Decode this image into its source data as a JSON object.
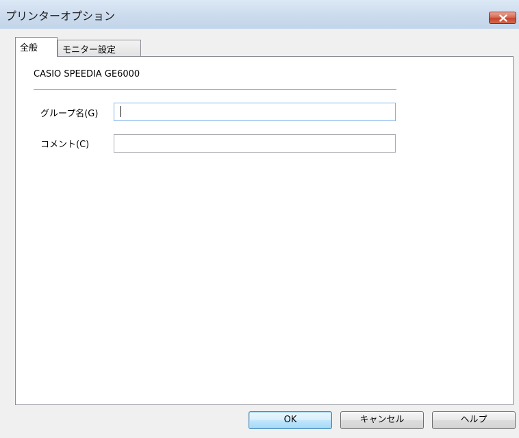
{
  "window": {
    "title": "プリンターオプション",
    "close_icon": "close-icon"
  },
  "tabs": [
    {
      "label": "全般",
      "active": true
    },
    {
      "label": "モニター設定",
      "active": false
    }
  ],
  "general": {
    "printer_name": "CASIO SPEEDIA GE6000",
    "group_label": "グループ名(G)",
    "group_value": "",
    "comment_label": "コメント(C)",
    "comment_value": ""
  },
  "buttons": {
    "ok": "OK",
    "cancel": "キャンセル",
    "help": "ヘルプ"
  },
  "colors": {
    "titlebar": "#c9d7e8",
    "close_button": "#c6452c",
    "default_button_border": "#3c7fb1"
  }
}
